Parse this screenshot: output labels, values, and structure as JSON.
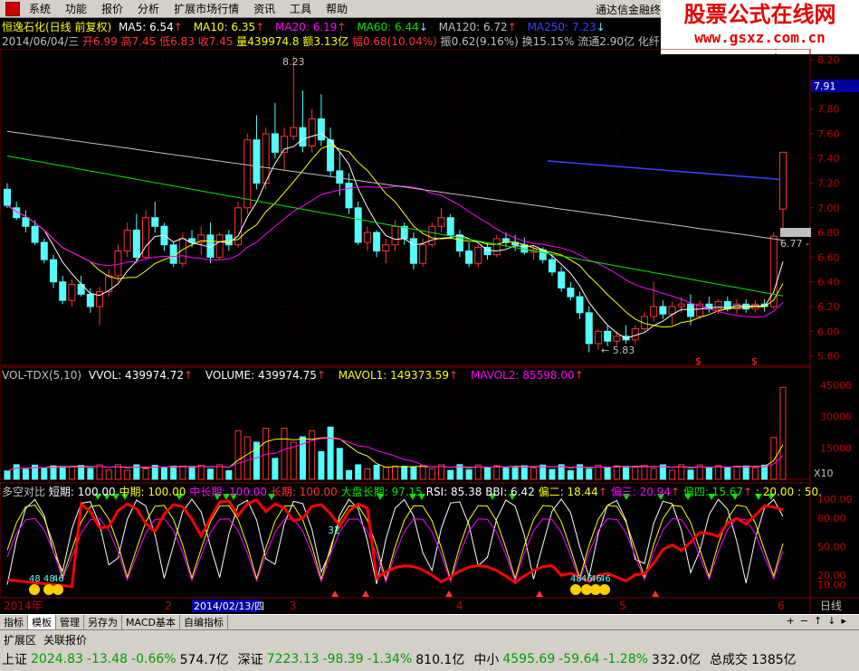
{
  "menu": [
    "系统",
    "功能",
    "报价",
    "分析",
    "扩展市场行情",
    "资讯",
    "工具",
    "帮助"
  ],
  "broker": "通达信金融终",
  "logo": {
    "line1": "股票公式在线网",
    "line2": "www.gsxz.com.cn"
  },
  "header": {
    "stock": "恒逸石化(日线 前复权)",
    "ma5": "MA5: 6.54",
    "ma10": "MA10: 6.35",
    "ma20": "MA20: 6.19",
    "ma60": "MA60: 6.44",
    "ma120": "MA120: 6.72",
    "ma250": "MA250: 7.23",
    "info": "2014/06/04/三",
    "open": "开6.99",
    "high": "高7.45",
    "low": "低6.83",
    "close": "收7.45",
    "vol": "量439974.8",
    "amt": "额3.13亿",
    "chg": "幅0.68(10.04%)",
    "amp": "振0.62(9.16%)",
    "turn": "换15.15%",
    "float": "流通2.90亿",
    "industry": "化纤"
  },
  "colors": {
    "up": "#ff3232",
    "down": "#54fcfc",
    "ma5": "#ffffff",
    "ma10": "#ffff00",
    "ma20": "#ff00ff",
    "ma60": "#00e600",
    "ma120": "#c0c0c0",
    "ma250": "#4040ff"
  },
  "price_axis": {
    "labels": [
      "8.20",
      "8.00",
      "7.80",
      "7.60",
      "7.40",
      "7.20",
      "7.00",
      "6.80",
      "6.60",
      "6.40",
      "6.20",
      "6.00",
      "5.80"
    ],
    "current": "7.91",
    "marker": "6.77",
    "high_mark": "8.23",
    "low_mark": "5.83"
  },
  "vol_header": {
    "name": "VOL-TDX(5,10)",
    "vvol": "VVOL: 439974.72",
    "volume": "VOLUME: 439974.75",
    "mavol1": "MAVOL1: 149373.59",
    "mavol2": "MAVOL2: 85598.00"
  },
  "vol_axis": {
    "labels": [
      "45000",
      "30000",
      "15000"
    ],
    "unit": "X10"
  },
  "ind_header": {
    "name": "多空对比",
    "short": "短期: 100.00",
    "mid": "中期: 100.00",
    "midlong": "中长期: 100.00",
    "long": "长期: 100.00",
    "market": "大盘长期: 97.15",
    "rsi": "RSI: 85.38",
    "bbi": "BBI: 6.42",
    "dev2": "偏二: 18.44",
    "dev3": "偏三: 20.94",
    "dev4": "偏四: 15.67",
    "extra": ": 20.00 : 50."
  },
  "ind_axis": {
    "labels": [
      "100.00",
      "80.00",
      "50.00",
      "20.00",
      "10.00"
    ],
    "note": "32",
    "smile_labels": [
      "48",
      "48",
      "46",
      "48",
      "46",
      "46",
      "46"
    ]
  },
  "time_axis": {
    "year": "2014年",
    "labels": [
      "2",
      "3",
      "4",
      "5",
      "6"
    ],
    "cursor": "2014/02/13/四",
    "period": "日线"
  },
  "tabs": [
    "指标",
    "模板",
    "管理",
    "另存为",
    "MACD基本",
    "自编指标"
  ],
  "tabs_selected": 1,
  "ext_tabs": [
    "扩展区",
    "关联报价"
  ],
  "status": {
    "sh_name": "上证",
    "sh_val": "2024.83",
    "sh_chg": "-13.48",
    "sh_pct": "-0.66%",
    "sh_amt": "574.7亿",
    "sz_name": "深证",
    "sz_val": "7223.13",
    "sz_chg": "-98.39",
    "sz_pct": "-1.34%",
    "sz_amt": "810.1亿",
    "zx_name": "中小",
    "zx_val": "4595.69",
    "zx_chg": "-59.64",
    "zx_pct": "-1.28%",
    "zx_amt": "332.0亿",
    "total_name": "总成交",
    "total_amt": "1385亿"
  }
}
